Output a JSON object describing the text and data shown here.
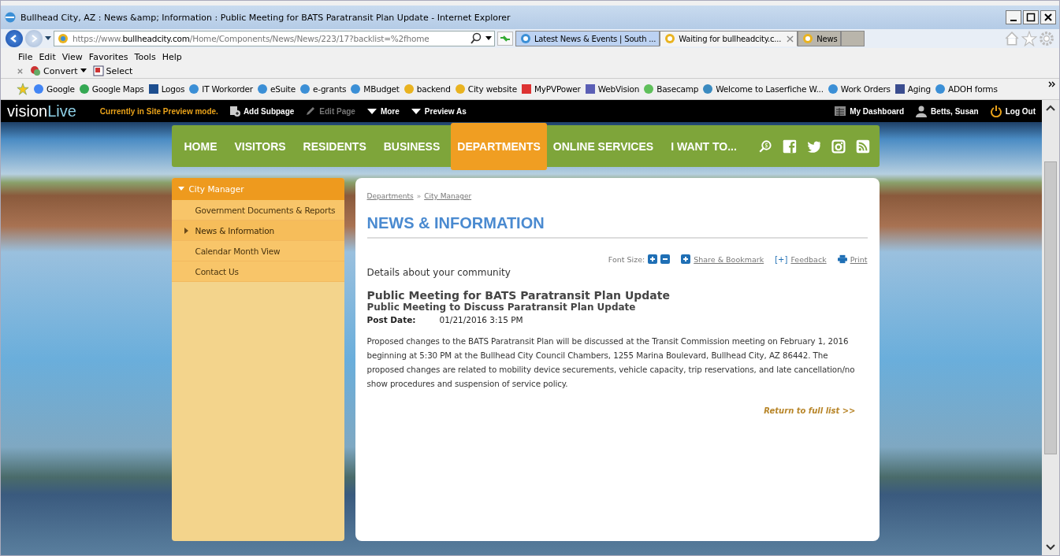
{
  "window": {
    "title": "Bullhead City, AZ : News &amp; Information : Public Meeting for BATS Paratransit Plan Update - Internet Explorer"
  },
  "address_bar": {
    "url_prefix": "https://www.",
    "url_domain": "bullheadcity.com",
    "url_path": "/Home/Components/News/News/223/17?backlist=%2fhome"
  },
  "tabs": [
    {
      "label": "Latest News & Events | South ...",
      "selected": false
    },
    {
      "label": "Waiting for bullheadcity.c...",
      "selected": true
    },
    {
      "label": "News",
      "selected": false
    }
  ],
  "menu": [
    "File",
    "Edit",
    "View",
    "Favorites",
    "Tools",
    "Help"
  ],
  "command_bar": [
    {
      "label": "Convert",
      "kind": "convert"
    },
    {
      "label": "Select",
      "kind": "select"
    }
  ],
  "favorites": [
    {
      "label": "Google",
      "kind": "google"
    },
    {
      "label": "Google Maps",
      "kind": "maps"
    },
    {
      "label": "Logos",
      "kind": "logos"
    },
    {
      "label": "IT Workorder",
      "kind": "ie"
    },
    {
      "label": "eSuite",
      "kind": "ie"
    },
    {
      "label": "e-grants",
      "kind": "ie"
    },
    {
      "label": "MBudget",
      "kind": "ie"
    },
    {
      "label": "backend",
      "kind": "site"
    },
    {
      "label": "City website",
      "kind": "site"
    },
    {
      "label": "MyPVPower",
      "kind": "power"
    },
    {
      "label": "WebVision",
      "kind": "grid"
    },
    {
      "label": "Basecamp",
      "kind": "hill"
    },
    {
      "label": "Welcome to Laserfiche W...",
      "kind": "globe"
    },
    {
      "label": "Work Orders",
      "kind": "ie"
    },
    {
      "label": "Aging",
      "kind": "doc"
    },
    {
      "label": "ADOH forms",
      "kind": "ie"
    }
  ],
  "cms_bar": {
    "logo_left": "vision",
    "logo_right": "Live",
    "status": "Currently in Site Preview mode.",
    "actions": [
      {
        "label": "Add Subpage",
        "kind": "add",
        "disabled": false
      },
      {
        "label": "Edit Page",
        "kind": "edit",
        "disabled": true
      },
      {
        "label": "More",
        "kind": "menu",
        "disabled": false
      },
      {
        "label": "Preview As",
        "kind": "menu",
        "disabled": false
      }
    ],
    "right": [
      {
        "label": "My Dashboard",
        "kind": "dashboard"
      },
      {
        "label": "Betts, Susan",
        "kind": "user"
      },
      {
        "label": "Log Out",
        "kind": "power"
      }
    ]
  },
  "nav": {
    "items": [
      {
        "label": "HOME",
        "selected": false
      },
      {
        "label": "VISITORS",
        "selected": false
      },
      {
        "label": "RESIDENTS",
        "selected": false
      },
      {
        "label": "BUSINESS",
        "selected": false
      },
      {
        "label": "DEPARTMENTS",
        "selected": true
      },
      {
        "label": "ONLINE SERVICES",
        "selected": false
      },
      {
        "label": "I WANT TO...",
        "selected": false
      }
    ]
  },
  "sidebar": {
    "heading": "City Manager",
    "items": [
      {
        "label": "Government Documents & Reports",
        "selected": false
      },
      {
        "label": "News & Information",
        "selected": true
      },
      {
        "label": "Calendar Month View",
        "selected": false
      },
      {
        "label": "Contact Us",
        "selected": false
      }
    ]
  },
  "content": {
    "breadcrumb": [
      "Departments",
      "City Manager"
    ],
    "breadcrumb_separator": "»",
    "title": "NEWS & INFORMATION",
    "font_size_label": "Font Size:",
    "share": "Share & Bookmark",
    "feedback_mark": "[+]",
    "feedback": "Feedback",
    "print": "Print",
    "intro": "Details about your community",
    "headline": "Public Meeting for BATS Paratransit Plan Update",
    "subtitle": "Public Meeting to Discuss Paratransit Plan Update",
    "post_date_label": "Post Date:",
    "post_date": "01/21/2016 3:15 PM",
    "body": "Proposed changes to the BATS Paratransit Plan will be discussed at the Transit Commission meeting on February 1, 2016 beginning at 5:30 PM at the Bullhead City Council Chambers, 1255 Marina Boulevard, Bullhead City, AZ 86442. The proposed changes are related to mobility device securements, vehicle capacity, trip reservations, and late cancellation/no show procedures and suspension of service policy.",
    "return_link": "Return to full list >>"
  }
}
